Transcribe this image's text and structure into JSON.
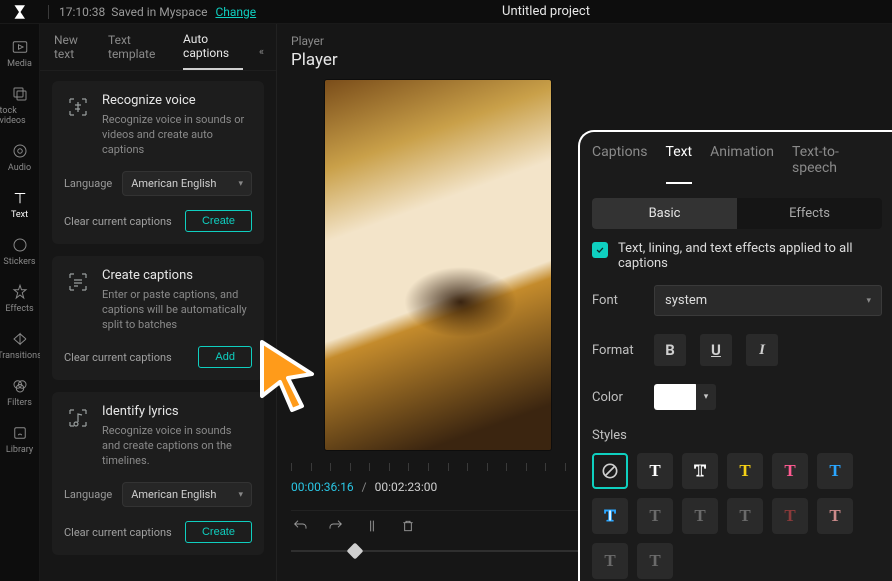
{
  "topbar": {
    "time": "17:10:38",
    "saved_text": "Saved in Myspace",
    "change_label": "Change",
    "project_title": "Untitled project"
  },
  "rail": {
    "items": [
      {
        "label": "Media",
        "icon": "media-icon"
      },
      {
        "label": "tock videos",
        "icon": "stock-videos-icon"
      },
      {
        "label": "Audio",
        "icon": "audio-icon"
      },
      {
        "label": "Text",
        "icon": "text-icon",
        "active": true
      },
      {
        "label": "Stickers",
        "icon": "stickers-icon"
      },
      {
        "label": "Effects",
        "icon": "effects-icon"
      },
      {
        "label": "Transitions",
        "icon": "transitions-icon"
      },
      {
        "label": "Filters",
        "icon": "filters-icon"
      },
      {
        "label": "Library",
        "icon": "library-icon"
      }
    ]
  },
  "panel_tabs": {
    "items": [
      "New text",
      "Text template",
      "Auto captions"
    ],
    "active_index": 2
  },
  "cards": {
    "recognize": {
      "title": "Recognize voice",
      "desc": "Recognize voice in sounds or videos and create auto captions",
      "language_label": "Language",
      "language_value": "American English",
      "clear_label": "Clear current captions",
      "create_label": "Create"
    },
    "create": {
      "title": "Create captions",
      "desc": "Enter or paste captions, and captions will be automatically split to batches",
      "clear_label": "Clear current captions",
      "add_label": "Add"
    },
    "lyrics": {
      "title": "Identify lyrics",
      "desc": "Recognize voice in sounds and create captions on the timelines.",
      "language_label": "Language",
      "language_value": "American English",
      "clear_label": "Clear current captions",
      "create_label": "Create"
    }
  },
  "player": {
    "label": "Player",
    "title": "Player",
    "current_time": "00:00:36:16",
    "duration": "00:02:23:00",
    "separator": "/"
  },
  "inspect": {
    "tabs": [
      "Captions",
      "Text",
      "Animation",
      "Text-to-speech"
    ],
    "active_tab_index": 1,
    "segments": [
      "Basic",
      "Effects"
    ],
    "active_segment_index": 0,
    "apply_all_label": "Text, lining, and text effects applied to all captions",
    "font_label": "Font",
    "font_value": "system",
    "format_label": "Format",
    "color_label": "Color",
    "color_value": "#FFFFFF",
    "styles_label": "Styles"
  }
}
